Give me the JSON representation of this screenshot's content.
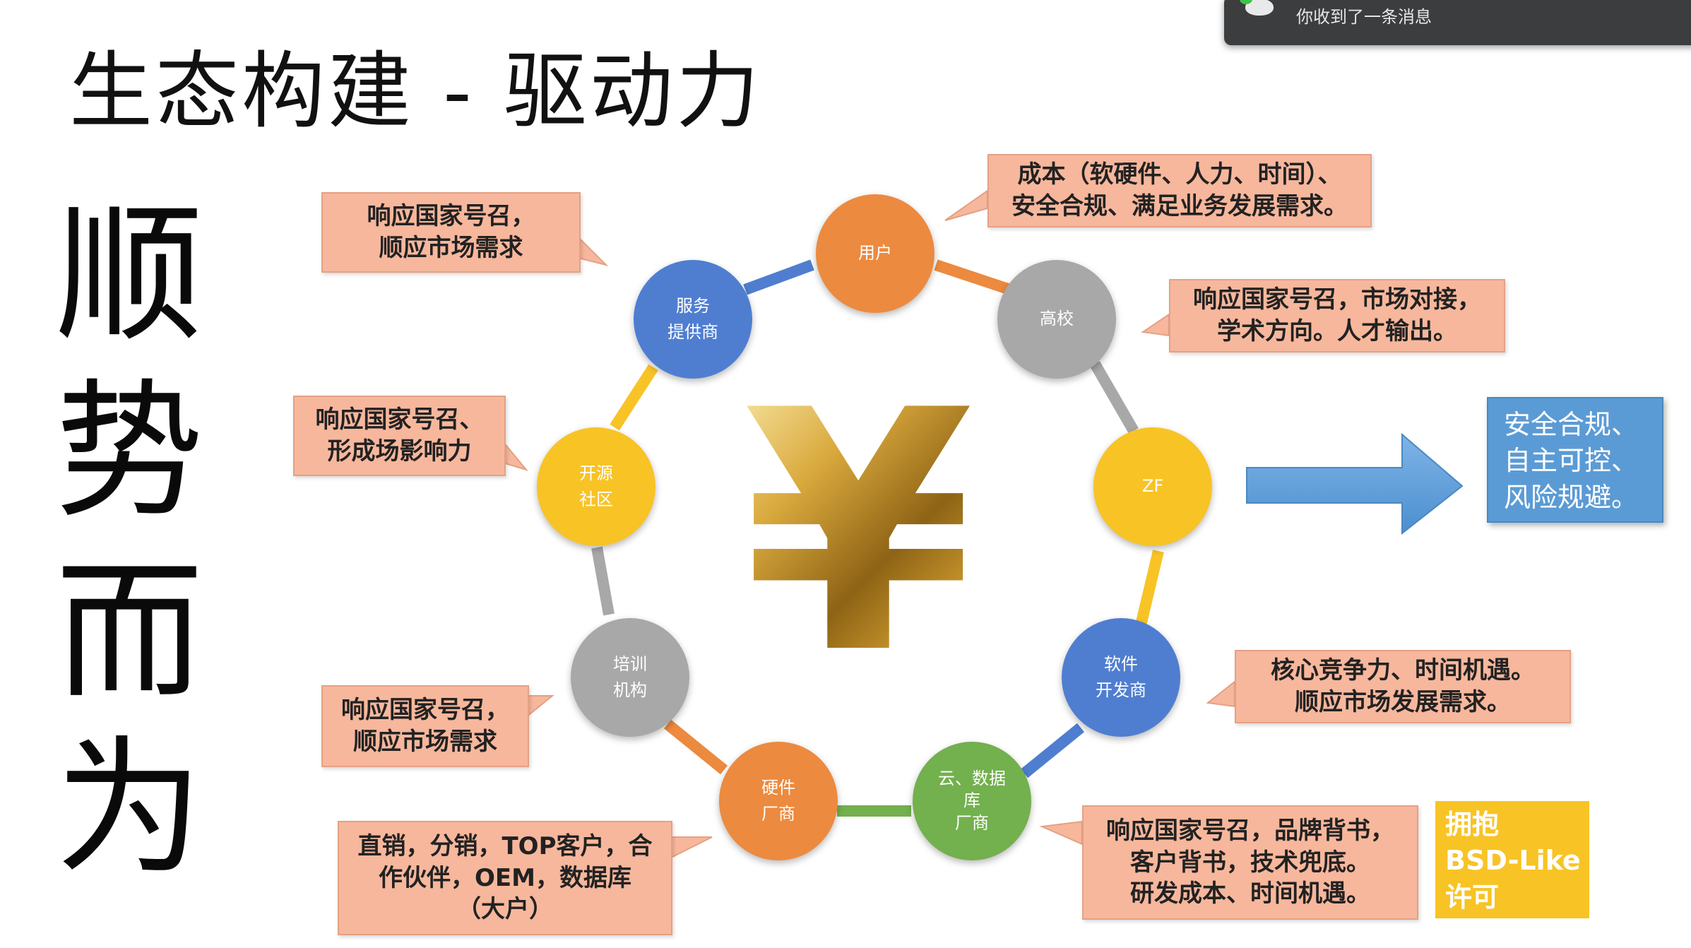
{
  "title": "生态构建 - 驱动力",
  "vertical_text": [
    "顺",
    "势",
    "而",
    "为"
  ],
  "center_symbol": "¥",
  "nodes": [
    {
      "lines": [
        "用户"
      ],
      "color": "#ec8a3f"
    },
    {
      "lines": [
        "高校"
      ],
      "color": "#a8a8a8"
    },
    {
      "lines": [
        "ZF"
      ],
      "color": "#f8c325"
    },
    {
      "lines": [
        "软件",
        "开发商"
      ],
      "color": "#4f7ed1"
    },
    {
      "lines": [
        "云、数据",
        "库",
        "厂商"
      ],
      "color": "#73b04e"
    },
    {
      "lines": [
        "硬件",
        "厂商"
      ],
      "color": "#ec8a3f"
    },
    {
      "lines": [
        "培训",
        "机构"
      ],
      "color": "#a8a8a8"
    },
    {
      "lines": [
        "开源",
        "社区"
      ],
      "color": "#f8c325"
    },
    {
      "lines": [
        "服务",
        "提供商"
      ],
      "color": "#4f7ed1"
    }
  ],
  "callouts": [
    {
      "lines": [
        "成本（软硬件、人力、时间）、",
        "安全合规、满足业务发展需求。"
      ]
    },
    {
      "lines": [
        "响应国家号召，市场对接，",
        "学术方向。人才输出。"
      ]
    },
    {
      "lines": [
        "核心竞争力、时间机遇。",
        "顺应市场发展需求。"
      ]
    },
    {
      "lines": [
        "响应国家号召，品牌背书，",
        "客户背书，技术兜底。",
        "研发成本、时间机遇。"
      ]
    },
    {
      "lines": [
        "直销，分销，TOP客户，合",
        "作伙伴，OEM，数据库",
        "（大户）"
      ]
    },
    {
      "lines": [
        "响应国家号召，",
        "顺应市场需求"
      ]
    },
    {
      "lines": [
        "响应国家号召、",
        "形成场影响力"
      ]
    },
    {
      "lines": [
        "响应国家号召，",
        "顺应市场需求"
      ]
    }
  ],
  "result_box": {
    "lines": [
      "安全合规、",
      "自主可控、",
      "风险规避。"
    ]
  },
  "bsd_box": {
    "lines": [
      "拥抱",
      "BSD-Like",
      "许可"
    ]
  },
  "notification": {
    "text": "你收到了一条消息"
  }
}
